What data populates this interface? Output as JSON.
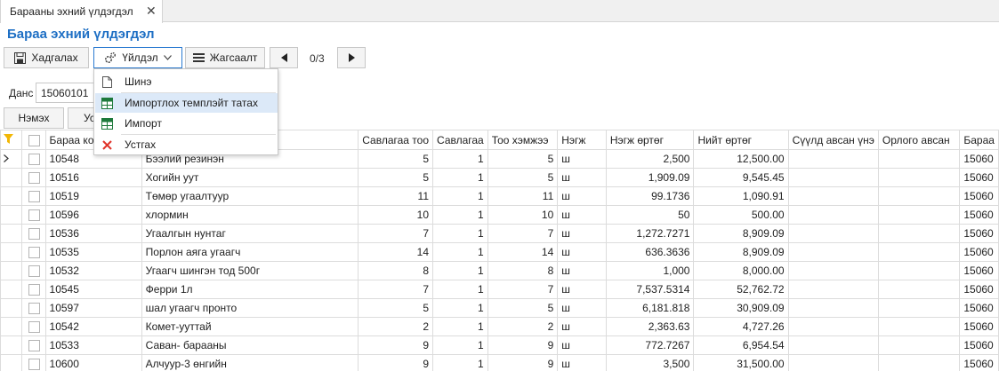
{
  "tab": {
    "label": "Барааны эхний үлдэгдэл",
    "close": "✕"
  },
  "page_title": "Бараа эхний үлдэгдэл",
  "toolbar": {
    "save_label": "Хадгалах",
    "action_label": "Үйлдэл",
    "list_label": "Жагсаалт",
    "pager_text": "0/3"
  },
  "account": {
    "label": "Данс",
    "value": "15060101"
  },
  "buttons": {
    "add_label": "Нэмэх",
    "second_label": "Ус"
  },
  "menu": {
    "items": [
      {
        "label": "Шинэ",
        "icon": "new-document-icon"
      },
      {
        "label": "Импортлох темплэйт татах",
        "icon": "excel-icon",
        "highlighted": true
      },
      {
        "label": "Импорт",
        "icon": "excel-icon"
      },
      {
        "label": "Устгах",
        "icon": "delete-x-icon"
      }
    ]
  },
  "colors": {
    "accent": "#1e6fc4",
    "filter": "#f2b705",
    "delete": "#e0342a",
    "excel": "#1e7a3c"
  },
  "grid": {
    "columns": [
      "",
      "",
      "Бараа ко",
      "",
      "Савлагаа тоо",
      "Савлагаа",
      "Тоо хэмжээ",
      "Нэгж",
      "Нэгж өртөг",
      "Нийт өртөг",
      "Сүүлд авсан үнэ",
      "Орлого авсан",
      "Бараа"
    ],
    "rows": [
      {
        "code": "10548",
        "name": "Бээлий резинэн",
        "pack_qty": "5",
        "pack": "1",
        "qty": "5",
        "unit": "ш",
        "unit_cost": "2,500",
        "total_cost": "12,500.00",
        "last_price": "",
        "income": "",
        "account": "15060"
      },
      {
        "code": "10516",
        "name": "Хогийн уут",
        "pack_qty": "5",
        "pack": "1",
        "qty": "5",
        "unit": "ш",
        "unit_cost": "1,909.09",
        "total_cost": "9,545.45",
        "last_price": "",
        "income": "",
        "account": "15060"
      },
      {
        "code": "10519",
        "name": "Төмөр угаалтуур",
        "pack_qty": "11",
        "pack": "1",
        "qty": "11",
        "unit": "ш",
        "unit_cost": "99.1736",
        "total_cost": "1,090.91",
        "last_price": "",
        "income": "",
        "account": "15060"
      },
      {
        "code": "10596",
        "name": "хлормин",
        "pack_qty": "10",
        "pack": "1",
        "qty": "10",
        "unit": "ш",
        "unit_cost": "50",
        "total_cost": "500.00",
        "last_price": "",
        "income": "",
        "account": "15060"
      },
      {
        "code": "10536",
        "name": "Угаалгын нунтаг",
        "pack_qty": "7",
        "pack": "1",
        "qty": "7",
        "unit": "ш",
        "unit_cost": "1,272.7271",
        "total_cost": "8,909.09",
        "last_price": "",
        "income": "",
        "account": "15060"
      },
      {
        "code": "10535",
        "name": "Порлон аяга угаагч",
        "pack_qty": "14",
        "pack": "1",
        "qty": "14",
        "unit": "ш",
        "unit_cost": "636.3636",
        "total_cost": "8,909.09",
        "last_price": "",
        "income": "",
        "account": "15060"
      },
      {
        "code": "10532",
        "name": "Угаагч шингэн тод 500г",
        "pack_qty": "8",
        "pack": "1",
        "qty": "8",
        "unit": "ш",
        "unit_cost": "1,000",
        "total_cost": "8,000.00",
        "last_price": "",
        "income": "",
        "account": "15060"
      },
      {
        "code": "10545",
        "name": "Ферри 1л",
        "pack_qty": "7",
        "pack": "1",
        "qty": "7",
        "unit": "ш",
        "unit_cost": "7,537.5314",
        "total_cost": "52,762.72",
        "last_price": "",
        "income": "",
        "account": "15060"
      },
      {
        "code": "10597",
        "name": "шал угаагч пронто",
        "pack_qty": "5",
        "pack": "1",
        "qty": "5",
        "unit": "ш",
        "unit_cost": "6,181.818",
        "total_cost": "30,909.09",
        "last_price": "",
        "income": "",
        "account": "15060"
      },
      {
        "code": "10542",
        "name": "Комет-ууттай",
        "pack_qty": "2",
        "pack": "1",
        "qty": "2",
        "unit": "ш",
        "unit_cost": "2,363.63",
        "total_cost": "4,727.26",
        "last_price": "",
        "income": "",
        "account": "15060"
      },
      {
        "code": "10533",
        "name": "Саван- барааны",
        "pack_qty": "9",
        "pack": "1",
        "qty": "9",
        "unit": "ш",
        "unit_cost": "772.7267",
        "total_cost": "6,954.54",
        "last_price": "",
        "income": "",
        "account": "15060"
      },
      {
        "code": "10600",
        "name": "Алчуур-3 өнгийн",
        "pack_qty": "9",
        "pack": "1",
        "qty": "9",
        "unit": "ш",
        "unit_cost": "3,500",
        "total_cost": "31,500.00",
        "last_price": "",
        "income": "",
        "account": "15060"
      }
    ]
  }
}
